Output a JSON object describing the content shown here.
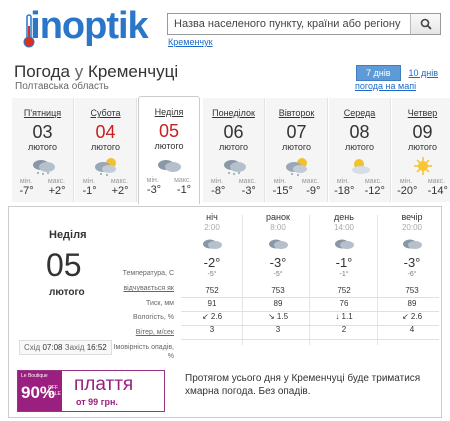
{
  "header": {
    "logo": "sinoptik",
    "search_placeholder": "Назва населеного пункту, країни або регіону",
    "search_hint": "Кременчук"
  },
  "title": {
    "prefix": "Погода",
    "preposition": "у",
    "city": "Кременчуці"
  },
  "region": "Полтавська область",
  "toggle": {
    "seven": "7 днів",
    "ten": "10 днів"
  },
  "map_link": "погода на мапі",
  "days": [
    {
      "name": "П'ятниця",
      "num": "03",
      "month": "лютого",
      "min_label": "мін.",
      "max_label": "макс.",
      "min": "-7°",
      "max": "+2°",
      "red": false,
      "icon": "cloudy-snow-icon"
    },
    {
      "name": "Субота",
      "num": "04",
      "month": "лютого",
      "min_label": "мін.",
      "max_label": "макс.",
      "min": "-1°",
      "max": "+2°",
      "red": true,
      "icon": "sun-cloud-snow-icon"
    },
    {
      "name": "Неділя",
      "num": "05",
      "month": "лютого",
      "min_label": "мін.",
      "max_label": "макс.",
      "min": "-3°",
      "max": "-1°",
      "red": true,
      "icon": "cloudy-icon"
    },
    {
      "name": "Понеділок",
      "num": "06",
      "month": "лютого",
      "min_label": "мін.",
      "max_label": "макс.",
      "min": "-8°",
      "max": "-3°",
      "red": false,
      "icon": "cloudy-snow-icon"
    },
    {
      "name": "Вівторок",
      "num": "07",
      "month": "лютого",
      "min_label": "мін.",
      "max_label": "макс.",
      "min": "-15°",
      "max": "-9°",
      "red": false,
      "icon": "sun-cloud-snow-icon"
    },
    {
      "name": "Середа",
      "num": "08",
      "month": "лютого",
      "min_label": "мін.",
      "max_label": "макс.",
      "min": "-18°",
      "max": "-12°",
      "red": false,
      "icon": "sun-cloud-icon"
    },
    {
      "name": "Четвер",
      "num": "09",
      "month": "лютого",
      "min_label": "мін.",
      "max_label": "макс.",
      "min": "-20°",
      "max": "-14°",
      "red": false,
      "icon": "sun-icon"
    }
  ],
  "detail": {
    "day_name": "Неділя",
    "day_num": "05",
    "month": "лютого",
    "sunrise_label": "Схід",
    "sunrise": "07:08",
    "sunset_label": "Захід",
    "sunset": "16:52",
    "row_labels": {
      "temp": "Температура, С",
      "feels": "відчувається як",
      "pressure": "Тиск, мм",
      "humidity": "Вологість, %",
      "wind": "Вітер, м/сек",
      "precip": "Імовірність опадів, %"
    },
    "periods": [
      {
        "name": "ніч",
        "time": "2:00",
        "temp": "-2°",
        "feels": "-5°",
        "pressure": "752",
        "humidity": "91",
        "wind_dir": "↙",
        "wind": "2.6"
      },
      {
        "name": "ранок",
        "time": "8:00",
        "temp": "-3°",
        "feels": "-5°",
        "pressure": "753",
        "humidity": "89",
        "wind_dir": "↘",
        "wind": "1.5"
      },
      {
        "name": "день",
        "time": "14:00",
        "temp": "-1°",
        "feels": "-1°",
        "pressure": "752",
        "humidity": "76",
        "wind_dir": "↓",
        "wind": "1.1"
      },
      {
        "name": "вечір",
        "time": "20:00",
        "temp": "-3°",
        "feels": "-6°",
        "pressure": "753",
        "humidity": "89",
        "wind_dir": "↙",
        "wind": "2.6"
      }
    ],
    "precip": [
      "3",
      "3",
      "2",
      "4"
    ],
    "description": "Протягом усього дня у Кременчуці буде триматися хмарна погода. Без опадів."
  },
  "ad": {
    "small": "Le Boutique",
    "percent": "90%",
    "off": "OFF",
    "sale": "SALE",
    "headline": "плаття",
    "price": "от 99 грн."
  },
  "colors": {
    "brand": "#2a77c9",
    "red_day": "#c8201e",
    "ad": "#9b1f7e"
  }
}
